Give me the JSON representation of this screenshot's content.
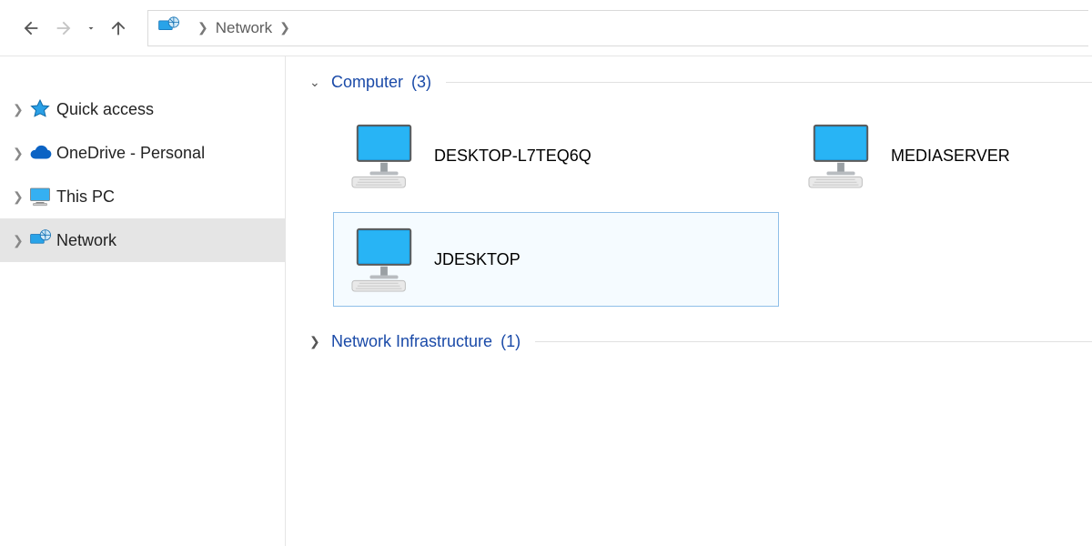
{
  "breadcrumb": {
    "location": "Network"
  },
  "sidebar": {
    "items": [
      {
        "label": "Quick access"
      },
      {
        "label": "OneDrive - Personal"
      },
      {
        "label": "This PC"
      },
      {
        "label": "Network"
      }
    ]
  },
  "groups": {
    "computer": {
      "title": "Computer",
      "count_suffix": "(3)"
    },
    "netinfra": {
      "title": "Network Infrastructure",
      "count_suffix": "(1)"
    }
  },
  "computers": [
    {
      "name": "DESKTOP-L7TEQ6Q"
    },
    {
      "name": "MEDIASERVER"
    },
    {
      "name": "JDESKTOP"
    }
  ]
}
